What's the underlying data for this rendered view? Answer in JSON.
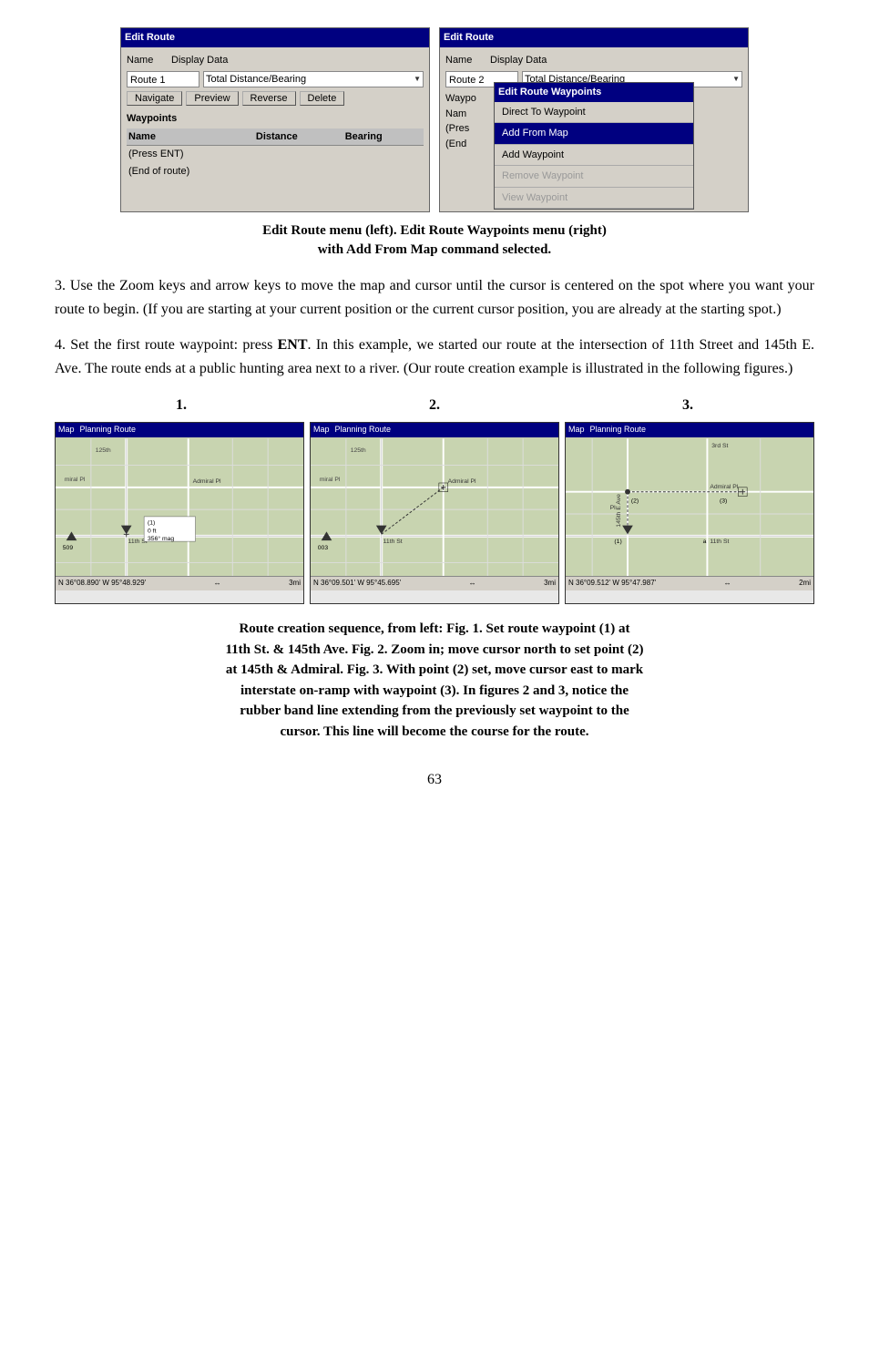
{
  "windows": {
    "left": {
      "title": "Edit Route",
      "name_label": "Name",
      "display_label": "Display Data",
      "route_value": "Route 1",
      "display_value": "Total Distance/Bearing",
      "buttons": [
        "Navigate",
        "Preview",
        "Reverse",
        "Delete"
      ],
      "waypoints_label": "Waypoints",
      "table_headers": [
        "Name",
        "Distance",
        "Bearing"
      ],
      "rows": [
        "(Press ENT)",
        "(End of route)"
      ]
    },
    "right": {
      "title": "Edit Route",
      "name_label": "Name",
      "display_label": "Display Data",
      "route_value": "Route 2",
      "display_value": "Total Distance/Bearing",
      "popup": {
        "title": "Edit Route Waypoints",
        "items": [
          {
            "label": "Direct To Waypoint",
            "state": "enabled"
          },
          {
            "label": "Add From Map",
            "state": "active"
          },
          {
            "label": "Add Waypoint",
            "state": "enabled"
          },
          {
            "label": "Remove Waypoint",
            "state": "disabled"
          },
          {
            "label": "View Waypoint",
            "state": "disabled"
          }
        ]
      },
      "table_partial": {
        "col1": [
          "Waypo",
          "Nam",
          "(Pres",
          "(End"
        ]
      }
    }
  },
  "caption_top": {
    "line1": "Edit Route menu (left). Edit Route Waypoints menu (right)",
    "line2": "with Add From Map command selected."
  },
  "paragraphs": {
    "p3": "3. Use the Zoom keys and arrow keys to move the map and cursor until the cursor is centered on the spot where you want your route to begin. (If you are starting at your current position or the current cursor position, you are already at the starting spot.)",
    "p4_before": "4. Set the first route waypoint: press ",
    "p4_bold": "ENT",
    "p4_after": ". In this example, we started our route at the intersection of 11th Street and 145th E. Ave. The route ends at a public hunting area next to a river. (Our route creation example is illustrated in the following figures.)"
  },
  "figures": {
    "labels": [
      "1.",
      "2.",
      "3."
    ],
    "maps": [
      {
        "title_parts": [
          "Map",
          "Planning Route"
        ],
        "bottom": {
          "coords": "N  36°08.890'  W  95°48.929'",
          "scale_icon": "↔",
          "scale": "3mi"
        },
        "info_box": {
          "line1": "(1)",
          "line2": "0 ft",
          "line3": "356° mag"
        }
      },
      {
        "title_parts": [
          "Map",
          "Planning Route"
        ],
        "bottom": {
          "coords": "N  36°09.501'  W  95°45.695'",
          "scale_icon": "↔",
          "scale": "3mi"
        }
      },
      {
        "title_parts": [
          "Map",
          "Planning Route"
        ],
        "bottom": {
          "coords": "N  36°09.512'  W  95°47.987'",
          "scale_icon": "↔",
          "scale": "2mi"
        }
      }
    ]
  },
  "caption_bottom": {
    "line1": "Route creation sequence, from left: Fig. 1. Set route waypoint (1) at",
    "line2": "11th St. & 145th Ave. Fig. 2. Zoom in; move cursor north to set point (2)",
    "line3": "at 145th & Admiral. Fig. 3. With point (2) set, move cursor east to mark",
    "line4": "interstate on-ramp with waypoint (3). In figures 2 and 3, notice the",
    "line5": "rubber band line extending from the previously set waypoint to the",
    "line6": "cursor. This line will become the course for the route."
  },
  "page_number": "63"
}
